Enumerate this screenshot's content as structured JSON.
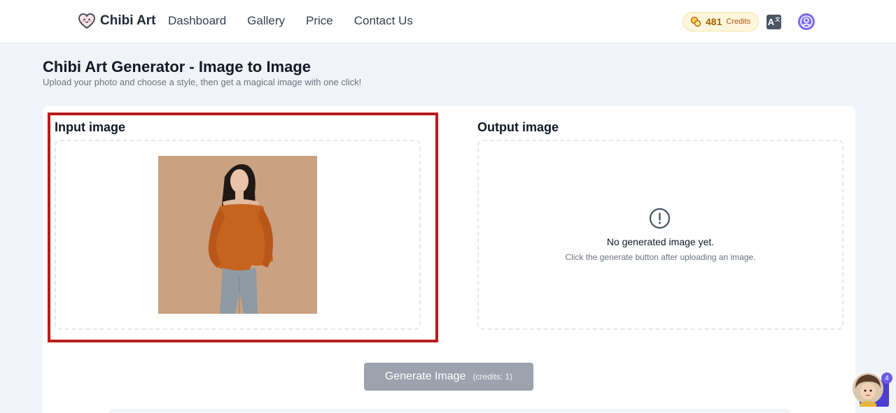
{
  "brand": {
    "name": "Chibi Art",
    "logo_icon": "heart-face-icon"
  },
  "nav": {
    "items": [
      {
        "label": "Dashboard"
      },
      {
        "label": "Gallery"
      },
      {
        "label": "Price"
      },
      {
        "label": "Contact Us"
      }
    ]
  },
  "account": {
    "credits_value": "481",
    "credits_label": "Credits",
    "credits_icon": "coins-icon",
    "language_icon": "translate-icon",
    "language_glyph": "A",
    "avatar_icon": "user-avatar-icon"
  },
  "page": {
    "title": "Chibi Art Generator - Image to Image",
    "subtitle": "Upload your photo and choose a style, then get a magical image with one click!"
  },
  "input_panel": {
    "title": "Input image"
  },
  "output_panel": {
    "title": "Output image",
    "empty_icon": "exclamation-circle-icon",
    "empty_title": "No generated image yet.",
    "empty_hint": "Click the generate button after uploading an image."
  },
  "generate": {
    "label": "Generate Image",
    "credits": "(credits: 1)"
  },
  "assistant": {
    "badge": "4"
  },
  "colors": {
    "highlight": "#b91c1c",
    "button_disabled": "#9ca3af",
    "accent": "#7c6cf2",
    "credits_text": "#a16207"
  }
}
